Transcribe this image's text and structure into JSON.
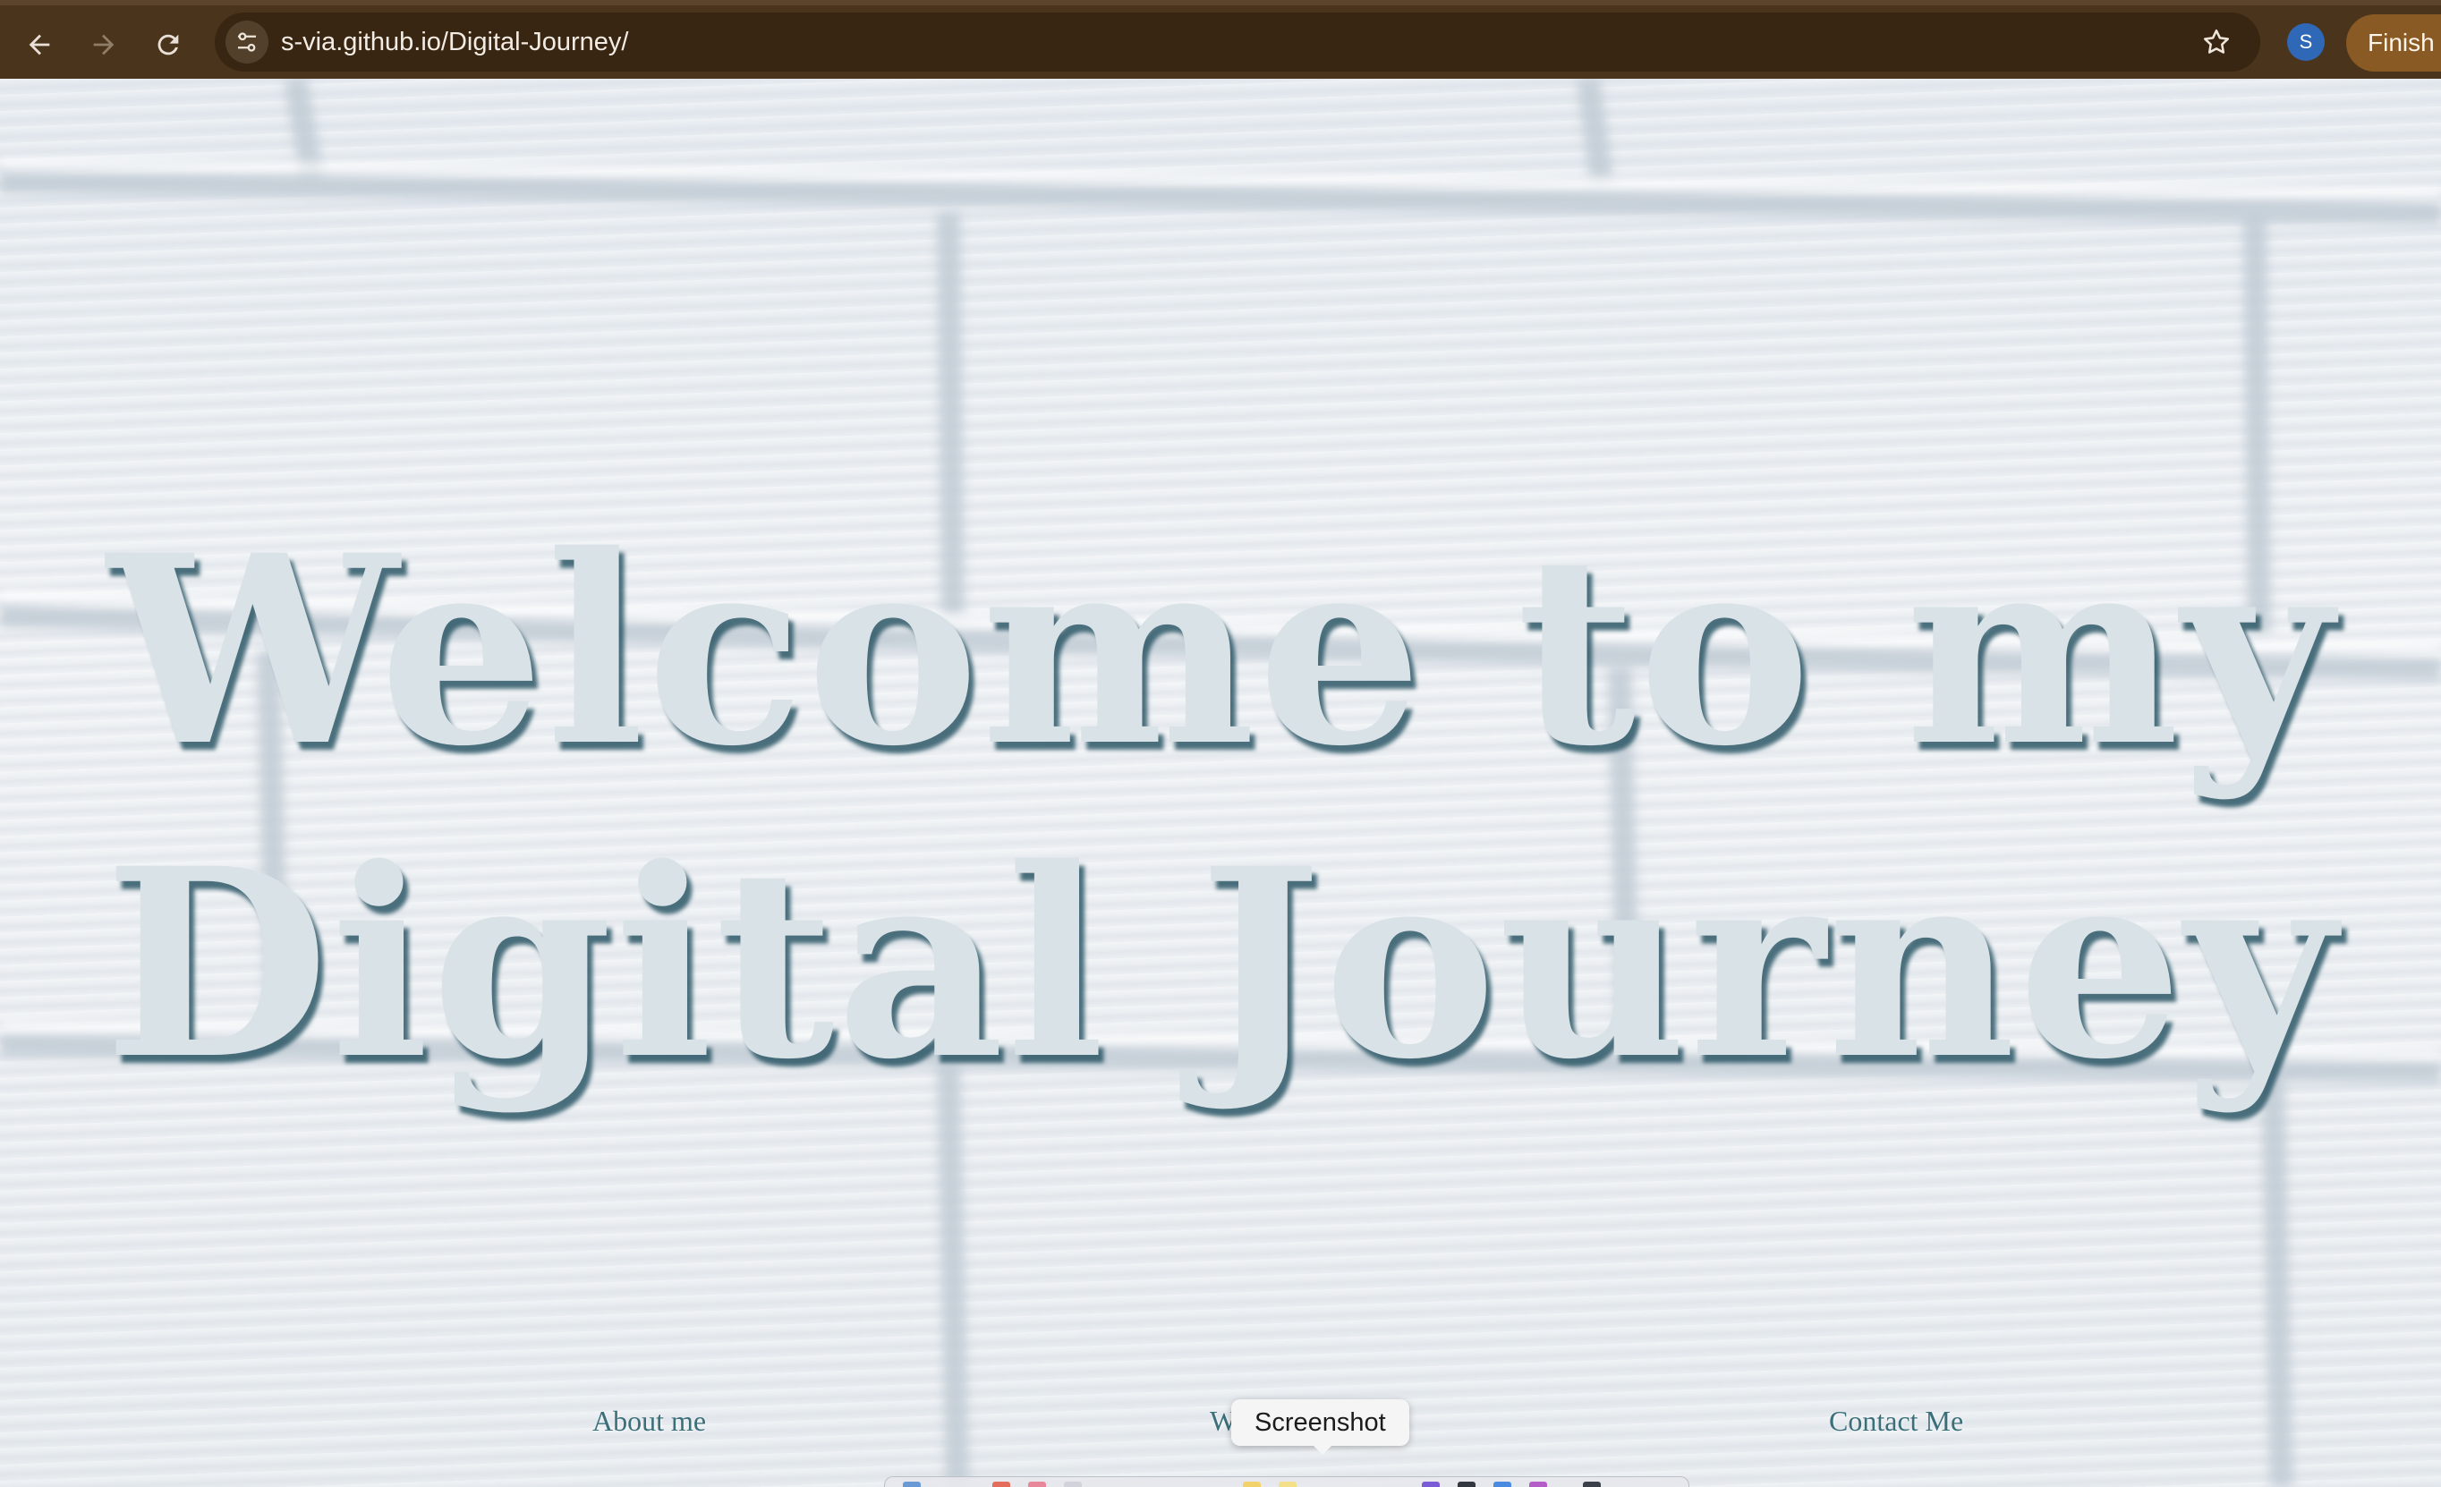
{
  "browser": {
    "url": "s-via.github.io/Digital-Journey/",
    "profile_initial": "S",
    "finish_label": "Finish",
    "icons": {
      "back": "arrow-left",
      "forward": "arrow-right",
      "reload": "reload",
      "site_info": "tune-sliders",
      "bookmark": "star-outline"
    },
    "colors": {
      "toolbar": "#4a341c",
      "omnibox": "#382612",
      "avatar": "#2f68b6",
      "finish_button": "#8a5a24"
    }
  },
  "page": {
    "hero": {
      "line1": "Welcome to my",
      "line2": "Digital Journey"
    },
    "nav": {
      "about": "About me",
      "work": "W",
      "contact": "Contact Me"
    },
    "colors": {
      "hero_text": "#d9e2e6",
      "hero_shadow": "#265262",
      "nav_text": "#3b6f7a",
      "background": "#e9edf1"
    }
  },
  "overlay": {
    "tooltip": "Screenshot"
  }
}
